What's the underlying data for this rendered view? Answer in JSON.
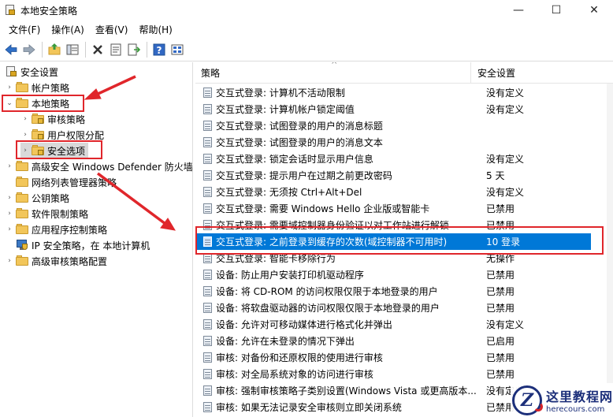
{
  "window": {
    "title": "本地安全策略",
    "minimize": "—",
    "maximize": "☐",
    "close": "✕"
  },
  "menu": [
    {
      "label": "文件(F)"
    },
    {
      "label": "操作(A)"
    },
    {
      "label": "查看(V)"
    },
    {
      "label": "帮助(H)"
    }
  ],
  "toolbar": [
    "back-icon",
    "forward-icon",
    "up-folder-icon",
    "show-tree-icon",
    "delete-icon",
    "properties-icon",
    "export-icon",
    "help-icon",
    "view-icon"
  ],
  "tree": {
    "root": "安全设置",
    "items": [
      {
        "label": "帐户策略",
        "caret": "›"
      },
      {
        "label": "本地策略",
        "caret": "⌄"
      },
      {
        "label": "审核策略",
        "caret": "›"
      },
      {
        "label": "用户权限分配",
        "caret": "›"
      },
      {
        "label": "安全选项",
        "caret": "›"
      },
      {
        "label": "高级安全 Windows Defender 防火墙",
        "caret": "›"
      },
      {
        "label": "网络列表管理器策略",
        "caret": ""
      },
      {
        "label": "公钥策略",
        "caret": "›"
      },
      {
        "label": "软件限制策略",
        "caret": "›"
      },
      {
        "label": "应用程序控制策略",
        "caret": "›"
      },
      {
        "label": "IP 安全策略，在 本地计算机",
        "caret": ""
      },
      {
        "label": "高级审核策略配置",
        "caret": "›"
      }
    ]
  },
  "list": {
    "col_policy": "策略",
    "col_setting": "安全设置",
    "sort_glyph": "^",
    "rows": [
      {
        "name": "交互式登录: 计算机不活动限制",
        "value": "没有定义"
      },
      {
        "name": "交互式登录: 计算机帐户锁定阈值",
        "value": "没有定义"
      },
      {
        "name": "交互式登录: 试图登录的用户的消息标题",
        "value": ""
      },
      {
        "name": "交互式登录: 试图登录的用户的消息文本",
        "value": ""
      },
      {
        "name": "交互式登录: 锁定会话时显示用户信息",
        "value": "没有定义"
      },
      {
        "name": "交互式登录: 提示用户在过期之前更改密码",
        "value": "5 天"
      },
      {
        "name": "交互式登录: 无须按 Ctrl+Alt+Del",
        "value": "没有定义"
      },
      {
        "name": "交互式登录: 需要 Windows Hello 企业版或智能卡",
        "value": "已禁用"
      },
      {
        "name": "交互式登录: 需要域控制器身份验证以对工作站进行解锁",
        "value": "已禁用"
      },
      {
        "name": "交互式登录: 之前登录到缓存的次数(域控制器不可用时)",
        "value": "10 登录"
      },
      {
        "name": "交互式登录: 智能卡移除行为",
        "value": "无操作"
      },
      {
        "name": "设备: 防止用户安装打印机驱动程序",
        "value": "已禁用"
      },
      {
        "name": "设备: 将 CD-ROM 的访问权限仅限于本地登录的用户",
        "value": "已禁用"
      },
      {
        "name": "设备: 将软盘驱动器的访问权限仅限于本地登录的用户",
        "value": "已禁用"
      },
      {
        "name": "设备: 允许对可移动媒体进行格式化并弹出",
        "value": "没有定义"
      },
      {
        "name": "设备: 允许在未登录的情况下弹出",
        "value": "已启用"
      },
      {
        "name": "审核: 对备份和还原权限的使用进行审核",
        "value": "已禁用"
      },
      {
        "name": "审核: 对全局系统对象的访问进行审核",
        "value": "已禁用"
      },
      {
        "name": "审核: 强制审核策略子类别设置(Windows Vista 或更高版本...",
        "value": "没有定义"
      },
      {
        "name": "审核: 如果无法记录安全审核则立即关闭系统",
        "value": "已禁用"
      }
    ],
    "selected_index": 9
  },
  "watermark": {
    "logo_letter": "Z",
    "name": "这里教程网",
    "url": "herecours.com"
  },
  "colors": {
    "selection": "#0078d7",
    "annotation": "#e0262b",
    "folder": "#f2c65a"
  }
}
